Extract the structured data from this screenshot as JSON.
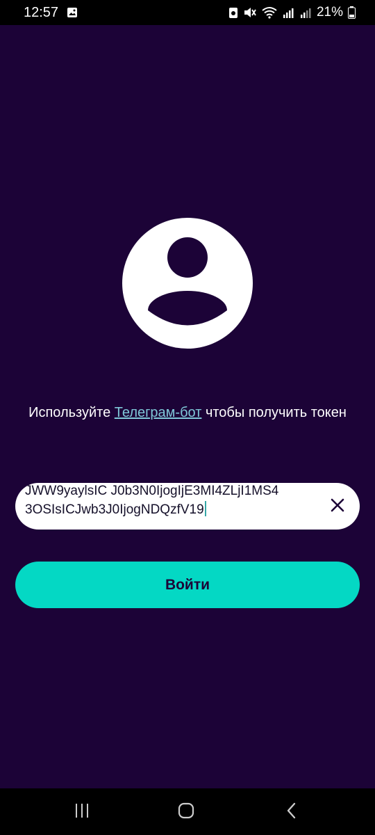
{
  "status_bar": {
    "time": "12:57",
    "battery": "21%",
    "icons": [
      "image-icon",
      "photo-capture-icon",
      "mute-icon",
      "wifi-icon",
      "signal-r-icon",
      "signal-icon",
      "battery-icon"
    ]
  },
  "message": {
    "before": "Используйте ",
    "link": "Телеграм-бот",
    "after": " чтобы получить токен"
  },
  "token_input": {
    "line1": "JWW9yaylsIC J0b3N0IjogIjE3MI4ZLjI1MS4",
    "line2": "3OSIsICJwb3J0IjogNDQzfV19"
  },
  "login_button": {
    "label": "Войти"
  },
  "colors": {
    "background": "#1c0337",
    "accent": "#04d8c4",
    "link": "#7fc8d8"
  }
}
